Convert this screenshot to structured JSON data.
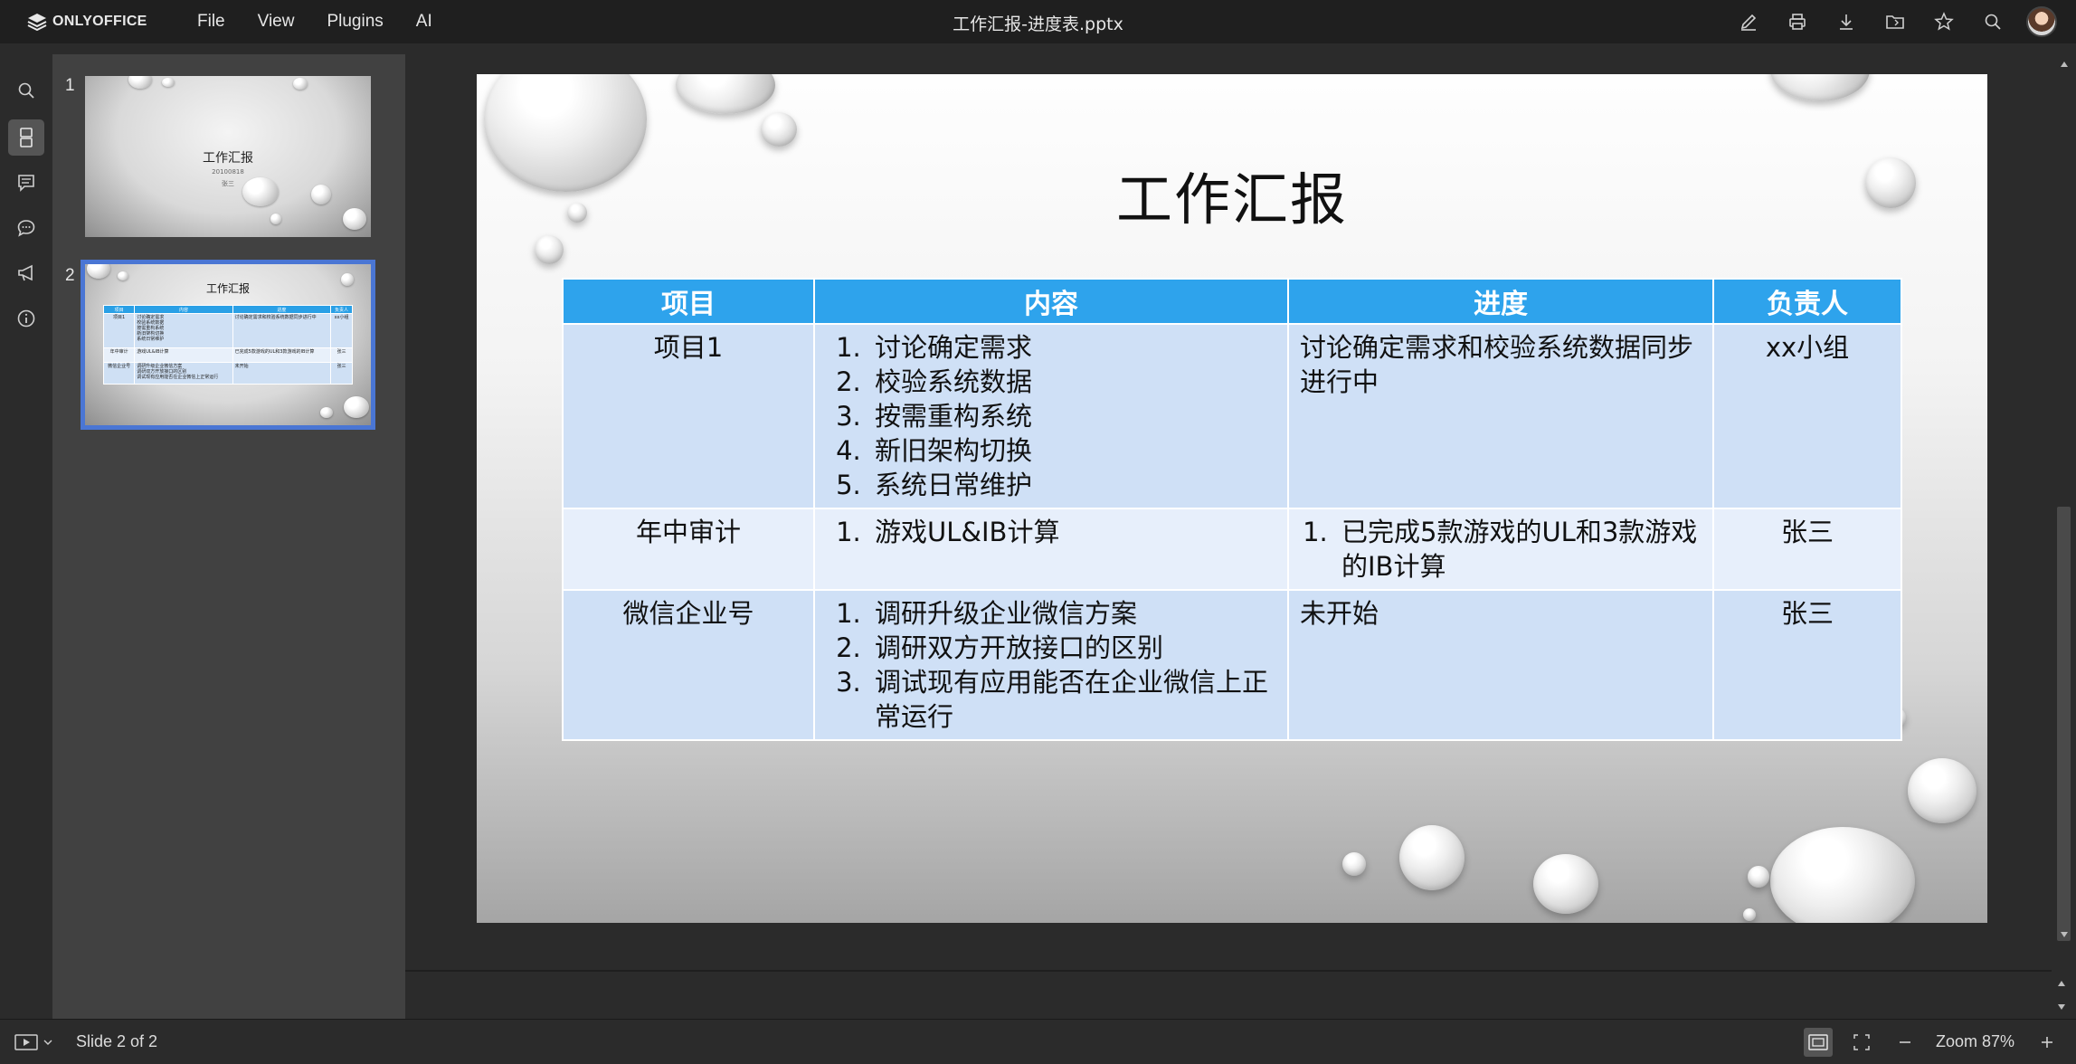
{
  "app": {
    "logo_text": "ONLYOFFICE",
    "doc_title": "工作汇报-进度表.pptx",
    "menu": [
      "File",
      "View",
      "Plugins",
      "AI"
    ]
  },
  "toolbar_icons": [
    "edit-icon",
    "print-icon",
    "download-icon",
    "open-location-icon",
    "favorite-icon",
    "search-icon"
  ],
  "rail_icons": [
    "search-icon",
    "slides-icon",
    "comments-icon",
    "chat-icon",
    "feedback-icon",
    "info-icon"
  ],
  "thumbnails": [
    {
      "number": "1",
      "title": "工作汇报",
      "date": "20100818",
      "author": "张三"
    },
    {
      "number": "2",
      "title": "工作汇报",
      "headers": [
        "项目",
        "内容",
        "进度",
        "负责人"
      ],
      "rows": [
        {
          "project": "项目1",
          "items": [
            "讨论确定需求",
            "校验系统数据",
            "按需重构系统",
            "新旧架构切换",
            "系统日常维护"
          ],
          "progress": "讨论确定需求和校验系统数据同步进行中",
          "owner": "xx小组"
        },
        {
          "project": "年中审计",
          "items": [
            "游戏UL&IB计算"
          ],
          "progress": "已完成5款游戏的UL和3款游戏的IB计算",
          "owner": "张三"
        },
        {
          "project": "微信企业号",
          "items": [
            "调研升级企业微信方案",
            "调研双方开放接口的区别",
            "调试现有应用能否在企业微信上正常运行"
          ],
          "progress": "未开始",
          "owner": "张三"
        }
      ]
    }
  ],
  "slide": {
    "title": "工作汇报",
    "headers": [
      "项目",
      "内容",
      "进度",
      "负责人"
    ],
    "rows": [
      {
        "project": "项目1",
        "items": [
          "讨论确定需求",
          "校验系统数据",
          "按需重构系统",
          "新旧架构切换",
          "系统日常维护"
        ],
        "progress": "讨论确定需求和校验系统数据同步进行中",
        "owner": "xx小组"
      },
      {
        "project": "年中审计",
        "items": [
          "游戏UL&IB计算"
        ],
        "progress_items": [
          "已完成5款游戏的UL和3款游戏的IB计算"
        ],
        "owner": "张三"
      },
      {
        "project": "微信企业号",
        "items": [
          "调研升级企业微信方案",
          "调研双方开放接口的区别",
          "调试现有应用能否在企业微信上正常运行"
        ],
        "progress": "未开始",
        "owner": "张三"
      }
    ]
  },
  "status": {
    "slide_counter": "Slide 2 of 2",
    "zoom": "Zoom 87%"
  },
  "colors": {
    "accent": "#4a76d4",
    "table_header": "#2ea3ec",
    "table_row": "#cfe0f6",
    "table_row_alt": "#e7effb"
  }
}
